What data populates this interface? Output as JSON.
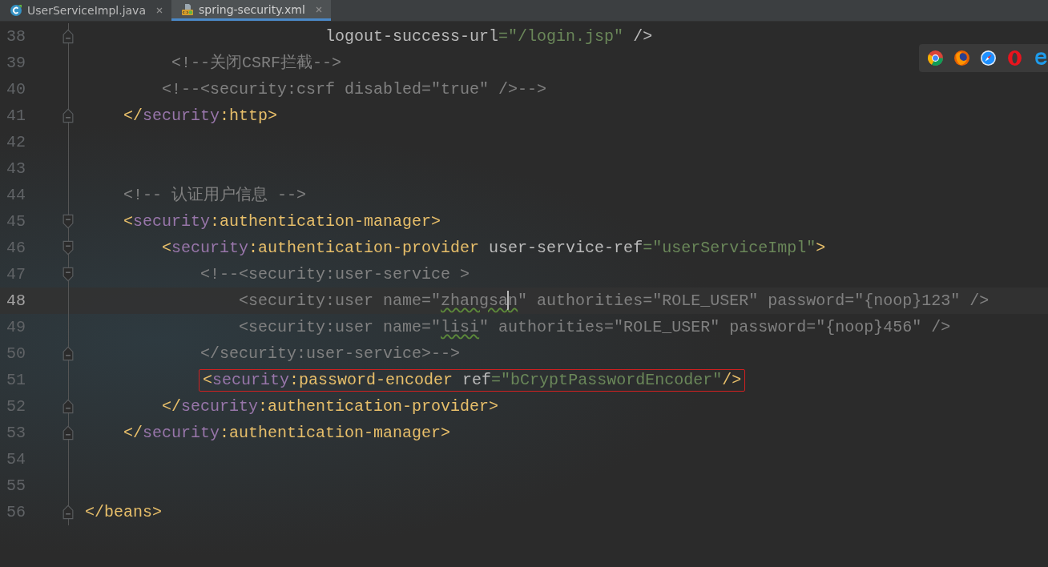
{
  "tabs": [
    {
      "label": "UserServiceImpl.java",
      "kind": "java",
      "selected": false
    },
    {
      "label": "spring-security.xml",
      "kind": "xml",
      "selected": true
    }
  ],
  "lines": [
    {
      "number": "38",
      "fold": {
        "kind": "end"
      },
      "tokens": [
        {
          "t": "                         logout-success-url",
          "kind": "attr"
        },
        {
          "t": "=\"/login.jsp\"",
          "kind": "value"
        },
        {
          "t": " />",
          "kind": "attr"
        }
      ]
    },
    {
      "number": "39",
      "tokens": [
        {
          "t": "         <!--关闭CSRF拦截-->",
          "kind": "comment"
        }
      ]
    },
    {
      "number": "40",
      "tokens": [
        {
          "t": "        <!--<security:csrf disabled=\"true\" />-->",
          "kind": "comment"
        }
      ]
    },
    {
      "number": "41",
      "fold": {
        "kind": "end"
      },
      "tokens": [
        {
          "t": "    </",
          "kind": "tag"
        },
        {
          "t": "security",
          "kind": "ns"
        },
        {
          "t": ":http>",
          "kind": "tag"
        }
      ]
    },
    {
      "number": "42"
    },
    {
      "number": "43"
    },
    {
      "number": "44",
      "tokens": [
        {
          "t": "    <!-- 认证用户信息 -->",
          "kind": "comment"
        }
      ]
    },
    {
      "number": "45",
      "fold": {
        "kind": "start"
      },
      "tokens": [
        {
          "t": "    <",
          "kind": "tag"
        },
        {
          "t": "security",
          "kind": "ns"
        },
        {
          "t": ":authentication-manager>",
          "kind": "tag"
        }
      ]
    },
    {
      "number": "46",
      "fold": {
        "kind": "start"
      },
      "tokens": [
        {
          "t": "        <",
          "kind": "tag"
        },
        {
          "t": "security",
          "kind": "ns"
        },
        {
          "t": ":authentication-provider",
          "kind": "tag"
        },
        {
          "t": " user-service-ref",
          "kind": "attr"
        },
        {
          "t": "=\"userServiceImpl\"",
          "kind": "value"
        },
        {
          "t": ">",
          "kind": "tag"
        }
      ]
    },
    {
      "number": "47",
      "fold": {
        "kind": "start"
      },
      "tokens": [
        {
          "t": "            <!--<security:user-service >",
          "kind": "comment"
        }
      ]
    },
    {
      "number": "48",
      "current": true,
      "tokens": [
        {
          "t": "                <security:user name=\"",
          "kind": "comment"
        },
        {
          "t": "zhangsa",
          "kind": "typo",
          "caret": true
        },
        {
          "t": "n",
          "kind": "typo"
        },
        {
          "t": "\" authorities=\"ROLE_USER\" password=\"{noop}123\" />",
          "kind": "comment"
        }
      ]
    },
    {
      "number": "49",
      "tokens": [
        {
          "t": "                <security:user name=\"",
          "kind": "comment"
        },
        {
          "t": "lisi",
          "kind": "typo"
        },
        {
          "t": "\" authorities=\"ROLE_USER\" password=\"{noop}456\" />",
          "kind": "comment"
        }
      ]
    },
    {
      "number": "50",
      "fold": {
        "kind": "end"
      },
      "tokens": [
        {
          "t": "            </security:user-service>-->",
          "kind": "comment"
        }
      ]
    },
    {
      "number": "51",
      "boxed": true,
      "tokens": [
        {
          "t": "            <",
          "kind": "tag"
        },
        {
          "t": "security",
          "kind": "ns"
        },
        {
          "t": ":password-encoder",
          "kind": "tag"
        },
        {
          "t": " ref",
          "kind": "attr"
        },
        {
          "t": "=\"bCryptPasswordEncoder\"",
          "kind": "value"
        },
        {
          "t": "/>",
          "kind": "tag"
        }
      ]
    },
    {
      "number": "52",
      "fold": {
        "kind": "end"
      },
      "tokens": [
        {
          "t": "        </",
          "kind": "tag"
        },
        {
          "t": "security",
          "kind": "ns"
        },
        {
          "t": ":authentication-provider>",
          "kind": "tag"
        }
      ]
    },
    {
      "number": "53",
      "fold": {
        "kind": "end"
      },
      "tokens": [
        {
          "t": "    </",
          "kind": "tag"
        },
        {
          "t": "security",
          "kind": "ns"
        },
        {
          "t": ":authentication-manager>",
          "kind": "tag"
        }
      ]
    },
    {
      "number": "54"
    },
    {
      "number": "55"
    },
    {
      "number": "56",
      "fold": {
        "kind": "end"
      },
      "tokens": [
        {
          "t": "</beans>",
          "kind": "tag"
        }
      ]
    }
  ]
}
